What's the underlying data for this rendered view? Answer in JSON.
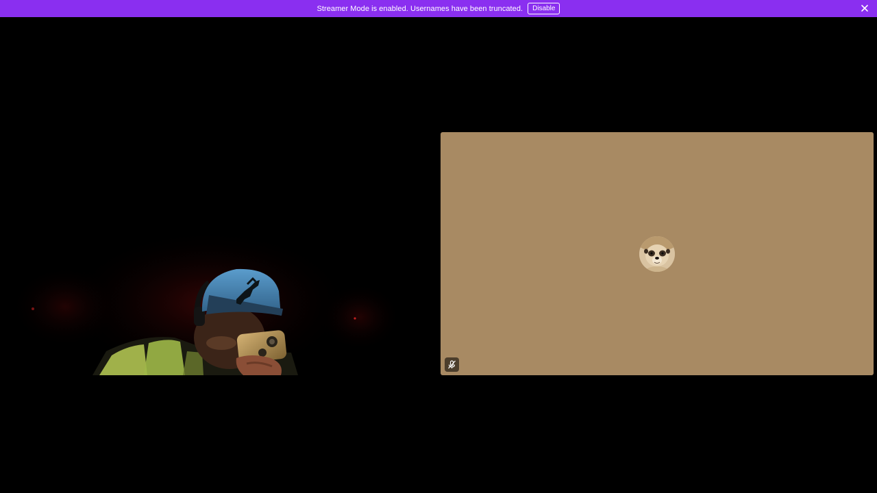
{
  "notice": {
    "text": "Streamer Mode is enabled. Usernames have been truncated.",
    "button_label": "Disable",
    "close_icon": "close-icon",
    "background_color": "#8a2ff0"
  },
  "stage": {
    "left_tile": {
      "content": "webcam-video"
    },
    "right_tile": {
      "background_color": "#a88a63",
      "avatar_icon": "meerkat-avatar",
      "status_icon": "mic-muted-icon"
    }
  }
}
